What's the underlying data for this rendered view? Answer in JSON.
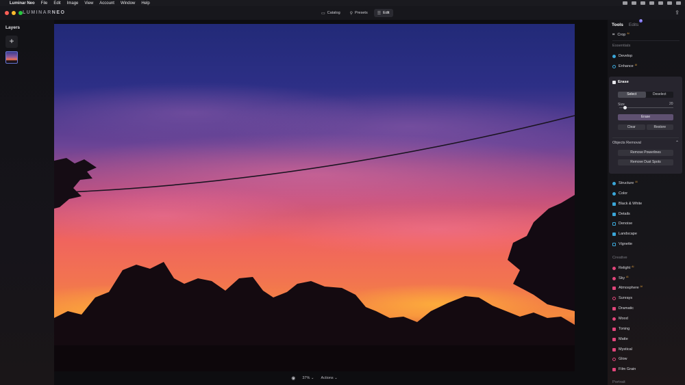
{
  "menubar": {
    "apple": "",
    "items": [
      "Luminar Neo",
      "File",
      "Edit",
      "Image",
      "View",
      "Account",
      "Window",
      "Help"
    ]
  },
  "app": {
    "logo_light": "LUMINAR",
    "logo_bold": "NEO"
  },
  "modes": [
    {
      "label": "Catalog",
      "icon": "folder-icon",
      "active": false
    },
    {
      "label": "Presets",
      "icon": "presets-icon",
      "active": false
    },
    {
      "label": "Edit",
      "icon": "edit-sliders-icon",
      "active": true
    }
  ],
  "layers": {
    "title": "Layers",
    "add_label": "+"
  },
  "tools_panel": {
    "tab_tools": "Tools",
    "tab_edits": "Edits",
    "edits_badge": "2",
    "crop": "Crop",
    "essentials_header": "Essentials",
    "essentials": [
      {
        "label": "Develop",
        "icon": "develop-icon",
        "color": "#3aa6d8",
        "ai": false
      },
      {
        "label": "Enhance",
        "icon": "enhance-icon",
        "color": "#3aa6d8",
        "ai": true
      }
    ],
    "erase": {
      "title": "Erase",
      "select": "Select",
      "deselect": "Deselect",
      "size_label": "Size",
      "size_value": "20",
      "size_fraction": 0.08,
      "erase_button": "Erase",
      "clear": "Clear",
      "restore": "Restore",
      "objects_removal": "Objects Removal",
      "remove_powerlines": "Remove Powerlines",
      "remove_dust_spots": "Remove Dust Spots"
    },
    "more_essentials": [
      {
        "label": "Structure",
        "icon": "structure-icon",
        "color": "#3aa6d8",
        "ai": true
      },
      {
        "label": "Color",
        "icon": "color-icon",
        "color": "#3aa6d8",
        "ai": false
      },
      {
        "label": "Black & White",
        "icon": "bw-icon",
        "color": "#3aa6d8",
        "ai": false
      },
      {
        "label": "Details",
        "icon": "details-icon",
        "color": "#3aa6d8",
        "ai": false
      },
      {
        "label": "Denoise",
        "icon": "denoise-icon",
        "color": "#3aa6d8",
        "ai": false
      },
      {
        "label": "Landscape",
        "icon": "landscape-icon",
        "color": "#3aa6d8",
        "ai": false
      },
      {
        "label": "Vignette",
        "icon": "vignette-icon",
        "color": "#3aa6d8",
        "ai": false
      }
    ],
    "creative_header": "Creative",
    "creative": [
      {
        "label": "Relight",
        "icon": "relight-icon",
        "color": "#e0457a",
        "ai": true
      },
      {
        "label": "Sky",
        "icon": "sky-icon",
        "color": "#e0457a",
        "ai": true
      },
      {
        "label": "Atmosphere",
        "icon": "atmosphere-icon",
        "color": "#e0457a",
        "ai": true
      },
      {
        "label": "Sunrays",
        "icon": "sunrays-icon",
        "color": "#e0457a",
        "ai": false
      },
      {
        "label": "Dramatic",
        "icon": "dramatic-icon",
        "color": "#e0457a",
        "ai": false
      },
      {
        "label": "Mood",
        "icon": "mood-icon",
        "color": "#e0457a",
        "ai": false
      },
      {
        "label": "Toning",
        "icon": "toning-icon",
        "color": "#e0457a",
        "ai": false
      },
      {
        "label": "Matte",
        "icon": "matte-icon",
        "color": "#e0457a",
        "ai": false
      },
      {
        "label": "Mystical",
        "icon": "mystical-icon",
        "color": "#e0457a",
        "ai": false
      },
      {
        "label": "Glow",
        "icon": "glow-icon",
        "color": "#e0457a",
        "ai": false
      },
      {
        "label": "Film Grain",
        "icon": "film-grain-icon",
        "color": "#e0457a",
        "ai": false
      }
    ],
    "portrait_header": "Portrait"
  },
  "bottombar": {
    "zoom": "37%",
    "actions": "Actions"
  },
  "colors": {
    "accent": "#7b6ff0",
    "ai_badge": "#e6a23c"
  }
}
